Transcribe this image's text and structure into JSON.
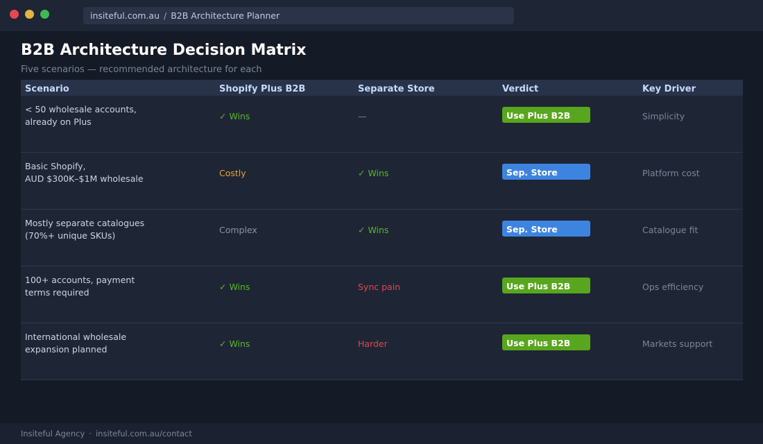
{
  "browser": {
    "url_domain": "insiteful.com.au",
    "url_separator": "/",
    "url_page": "B2B Architecture Planner"
  },
  "page": {
    "title": "B2B Architecture Decision Matrix",
    "subtitle": "Five scenarios — recommended architecture for each"
  },
  "table": {
    "headers": [
      "Scenario",
      "Shopify Plus B2B",
      "Separate Store",
      "Verdict",
      "Key Driver"
    ],
    "rows": [
      {
        "scenario": [
          "< 50 wholesale accounts,",
          "already on Plus"
        ],
        "shopify_plus": "✓ Wins",
        "separate_store": "—",
        "verdict": "Use Plus B2B",
        "driver": "Simplicity"
      },
      {
        "scenario": [
          "Basic Shopify,",
          "AUD $300K–$1M wholesale"
        ],
        "shopify_plus": "Costly",
        "separate_store": "✓ Wins",
        "verdict": "Sep. Store",
        "driver": "Platform cost"
      },
      {
        "scenario": [
          "Mostly separate catalogues",
          "(70%+ unique SKUs)"
        ],
        "shopify_plus": "Complex",
        "separate_store": "✓ Wins",
        "verdict": "Sep. Store",
        "driver": "Catalogue fit"
      },
      {
        "scenario": [
          "100+ accounts, payment",
          "terms required"
        ],
        "shopify_plus": "✓ Wins",
        "separate_store": "Sync pain",
        "verdict": "Use Plus B2B",
        "driver": "Ops efficiency"
      },
      {
        "scenario": [
          "International wholesale",
          "expansion planned"
        ],
        "shopify_plus": "✓ Wins",
        "separate_store": "Harder",
        "verdict": "Use Plus B2B",
        "driver": "Markets support"
      }
    ]
  },
  "footer": {
    "agency": "Insiteful Agency",
    "separator": "·",
    "contact": "insiteful.com.au/contact"
  },
  "colors": {
    "background": "#141a26",
    "header_row": "#283349",
    "row": "#1e2535",
    "win_green": "#5bb82a",
    "plus_badge": "#58a61d",
    "sep_badge": "#3d84e0",
    "costly_amber": "#e3a52b",
    "negative_red": "#e0474f"
  }
}
